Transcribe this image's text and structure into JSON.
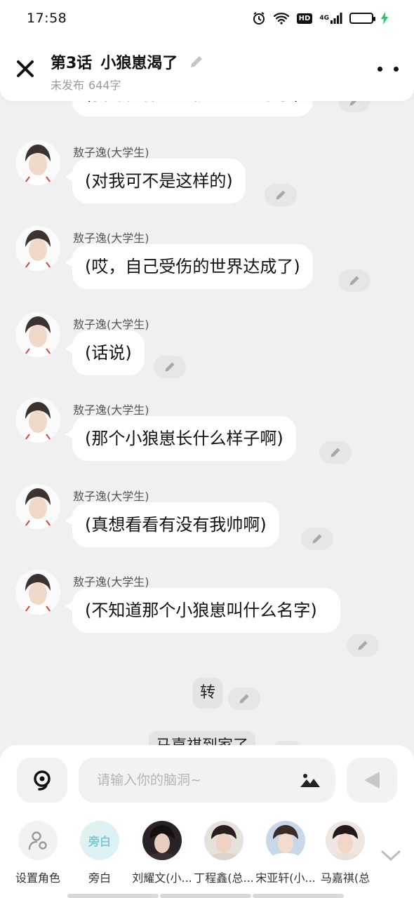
{
  "status_bar": {
    "time": "17:58",
    "network": "4G",
    "hd": "HD",
    "battery_level": 0.85,
    "accent": "#2fc26a"
  },
  "header": {
    "chapter": "第3话",
    "title": "小狼崽渴了",
    "status": "未发布",
    "word_count": "644字"
  },
  "messages": [
    {
      "sender": "",
      "text": "(我哥他什么时候这么温柔了)"
    },
    {
      "sender": "敖子逸(大学生)",
      "text": "(对我可不是这样的)"
    },
    {
      "sender": "敖子逸(大学生)",
      "text": "(哎，自己受伤的世界达成了)"
    },
    {
      "sender": "敖子逸(大学生)",
      "text": "(话说)"
    },
    {
      "sender": "敖子逸(大学生)",
      "text": "(那个小狼崽长什么样子啊)"
    },
    {
      "sender": "敖子逸(大学生)",
      "text": "(真想看看有没有我帅啊)"
    },
    {
      "sender": "敖子逸(大学生)",
      "text": "(不知道那个小狼崽叫什么名字)"
    }
  ],
  "narration": [
    {
      "text": "转"
    },
    {
      "text": "马嘉祺到家了"
    }
  ],
  "input": {
    "placeholder": "请输入你的脑洞~"
  },
  "roles": [
    {
      "label": "设置角色"
    },
    {
      "label": "旁白",
      "badge": "旁白"
    },
    {
      "label": "刘耀文(小..."
    },
    {
      "label": "丁程鑫(总..."
    },
    {
      "label": "宋亚轩(小..."
    },
    {
      "label": "马嘉祺(总"
    }
  ]
}
